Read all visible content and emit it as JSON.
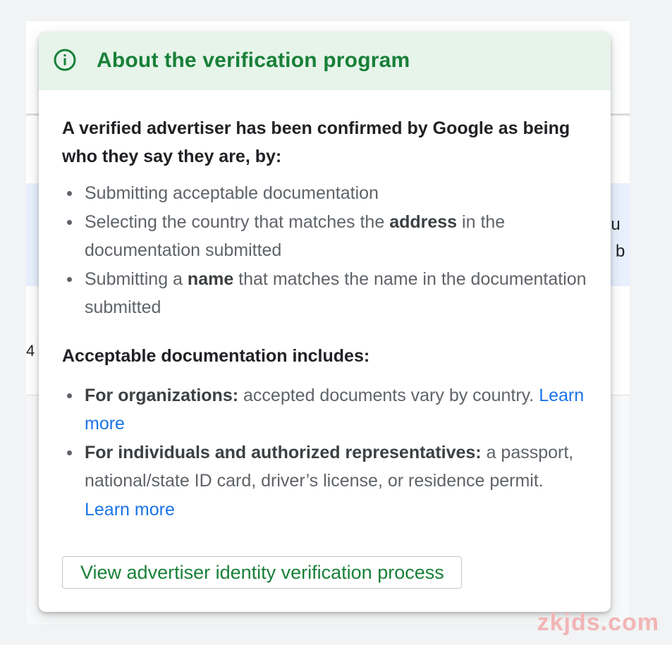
{
  "background": {
    "banner_text_lines": [
      "ou",
      "ir b"
    ],
    "number": "4"
  },
  "popup": {
    "icon": "info-icon",
    "title": "About the verification program",
    "intro": "A verified advertiser has been confirmed by Google as being who they say they are, by:",
    "verification_bullets": [
      {
        "pre": "Submitting acceptable documentation",
        "bold": "",
        "post": ""
      },
      {
        "pre": "Selecting the country that matches the ",
        "bold": "address",
        "post": " in the documentation submitted"
      },
      {
        "pre": "Submitting a ",
        "bold": "name",
        "post": " that matches the name in the documentation submitted"
      }
    ],
    "docs_heading": "Acceptable documentation includes:",
    "docs_bullets": [
      {
        "bold": "For organizations:",
        "text": " accepted documents vary by country. ",
        "link": "Learn more"
      },
      {
        "bold": "For individuals and authorized representatives:",
        "text": " a passport, national/state ID card, driver’s license, or residence permit. ",
        "link": "Learn more"
      }
    ],
    "button_label": "View advertiser identity verification process"
  },
  "watermark": "zkjds.com",
  "colors": {
    "header_bg": "#e6f4ea",
    "title_green": "#188038",
    "link_blue": "#1a73e8",
    "body_gray": "#5f6368"
  }
}
